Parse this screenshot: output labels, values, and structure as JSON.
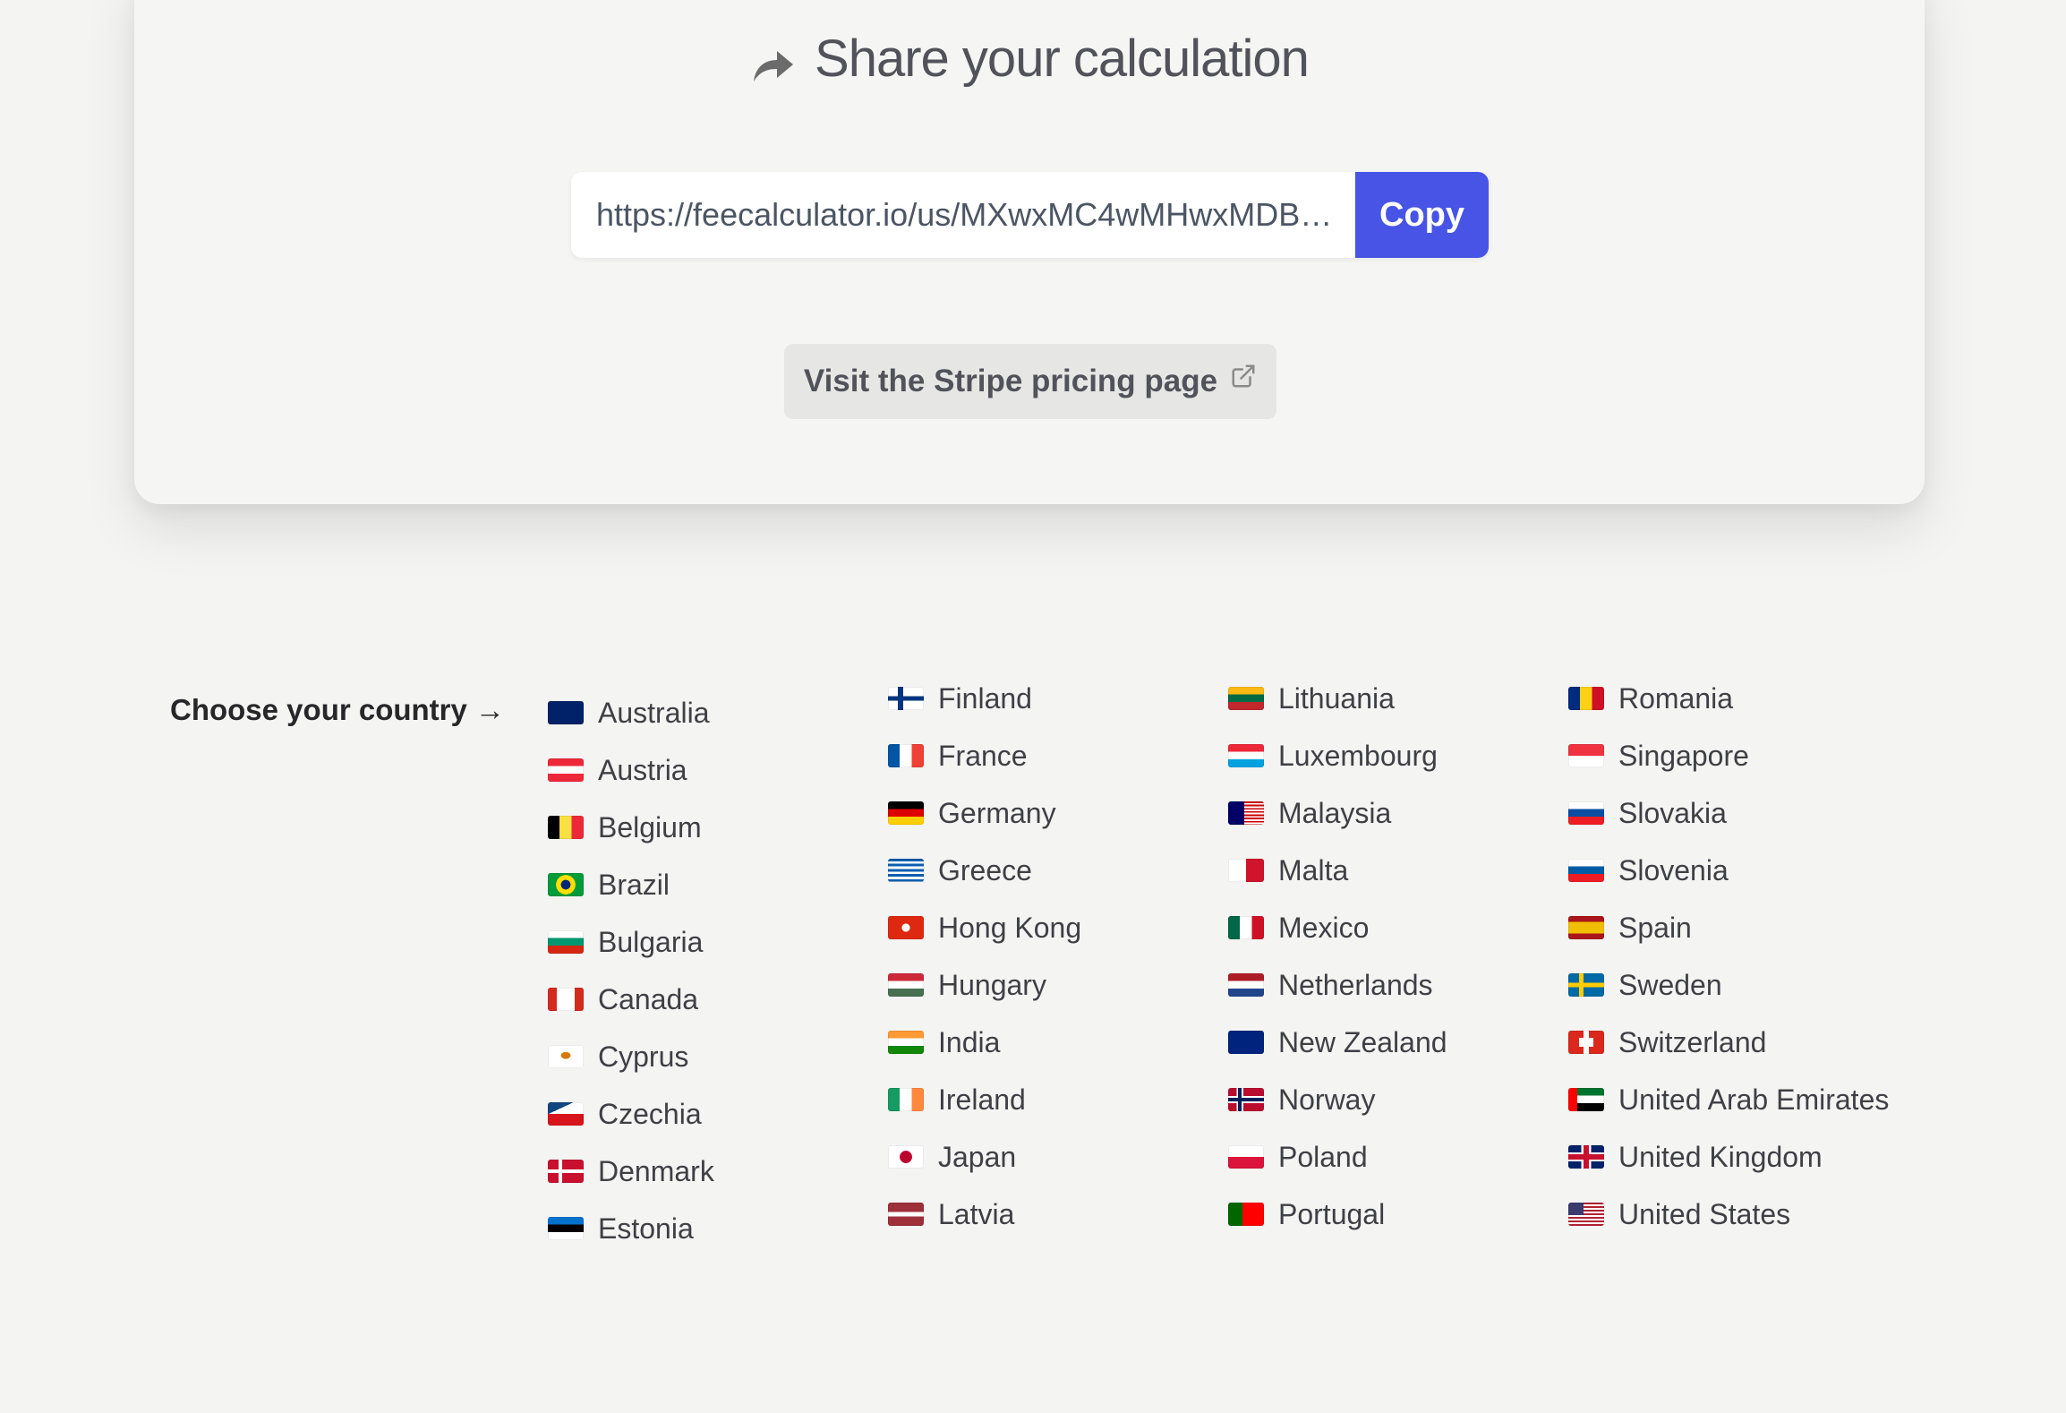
{
  "share": {
    "title": "Share your calculation",
    "url": "https://feecalculator.io/us/MXwxMC4wMHwxMDB…",
    "copy_label": "Copy",
    "stripe_link_label": "Visit the Stripe pricing page"
  },
  "countries": {
    "choose_label": "Choose your country →",
    "columns": [
      [
        {
          "name": "Australia",
          "flag": "au"
        },
        {
          "name": "Austria",
          "flag": "at"
        },
        {
          "name": "Belgium",
          "flag": "be"
        },
        {
          "name": "Brazil",
          "flag": "br"
        },
        {
          "name": "Bulgaria",
          "flag": "bg"
        },
        {
          "name": "Canada",
          "flag": "ca"
        },
        {
          "name": "Cyprus",
          "flag": "cy"
        },
        {
          "name": "Czechia",
          "flag": "cz"
        },
        {
          "name": "Denmark",
          "flag": "dk"
        },
        {
          "name": "Estonia",
          "flag": "ee"
        }
      ],
      [
        {
          "name": "Finland",
          "flag": "fi"
        },
        {
          "name": "France",
          "flag": "fr"
        },
        {
          "name": "Germany",
          "flag": "de"
        },
        {
          "name": "Greece",
          "flag": "gr"
        },
        {
          "name": "Hong Kong",
          "flag": "hk"
        },
        {
          "name": "Hungary",
          "flag": "hu"
        },
        {
          "name": "India",
          "flag": "in"
        },
        {
          "name": "Ireland",
          "flag": "ie"
        },
        {
          "name": "Japan",
          "flag": "jp"
        },
        {
          "name": "Latvia",
          "flag": "lv"
        }
      ],
      [
        {
          "name": "Lithuania",
          "flag": "lt"
        },
        {
          "name": "Luxembourg",
          "flag": "lu"
        },
        {
          "name": "Malaysia",
          "flag": "my"
        },
        {
          "name": "Malta",
          "flag": "mt"
        },
        {
          "name": "Mexico",
          "flag": "mx"
        },
        {
          "name": "Netherlands",
          "flag": "nl"
        },
        {
          "name": "New Zealand",
          "flag": "nz"
        },
        {
          "name": "Norway",
          "flag": "no"
        },
        {
          "name": "Poland",
          "flag": "pl"
        },
        {
          "name": "Portugal",
          "flag": "pt"
        }
      ],
      [
        {
          "name": "Romania",
          "flag": "ro"
        },
        {
          "name": "Singapore",
          "flag": "sg"
        },
        {
          "name": "Slovakia",
          "flag": "sk"
        },
        {
          "name": "Slovenia",
          "flag": "si"
        },
        {
          "name": "Spain",
          "flag": "es"
        },
        {
          "name": "Sweden",
          "flag": "se"
        },
        {
          "name": "Switzerland",
          "flag": "ch"
        },
        {
          "name": "United Arab Emirates",
          "flag": "ae"
        },
        {
          "name": "United Kingdom",
          "flag": "gb"
        },
        {
          "name": "United States",
          "flag": "us"
        }
      ]
    ]
  },
  "colors": {
    "accent": "#4754e6",
    "background": "#f4f4f2",
    "button_secondary": "#e6e6e4"
  }
}
